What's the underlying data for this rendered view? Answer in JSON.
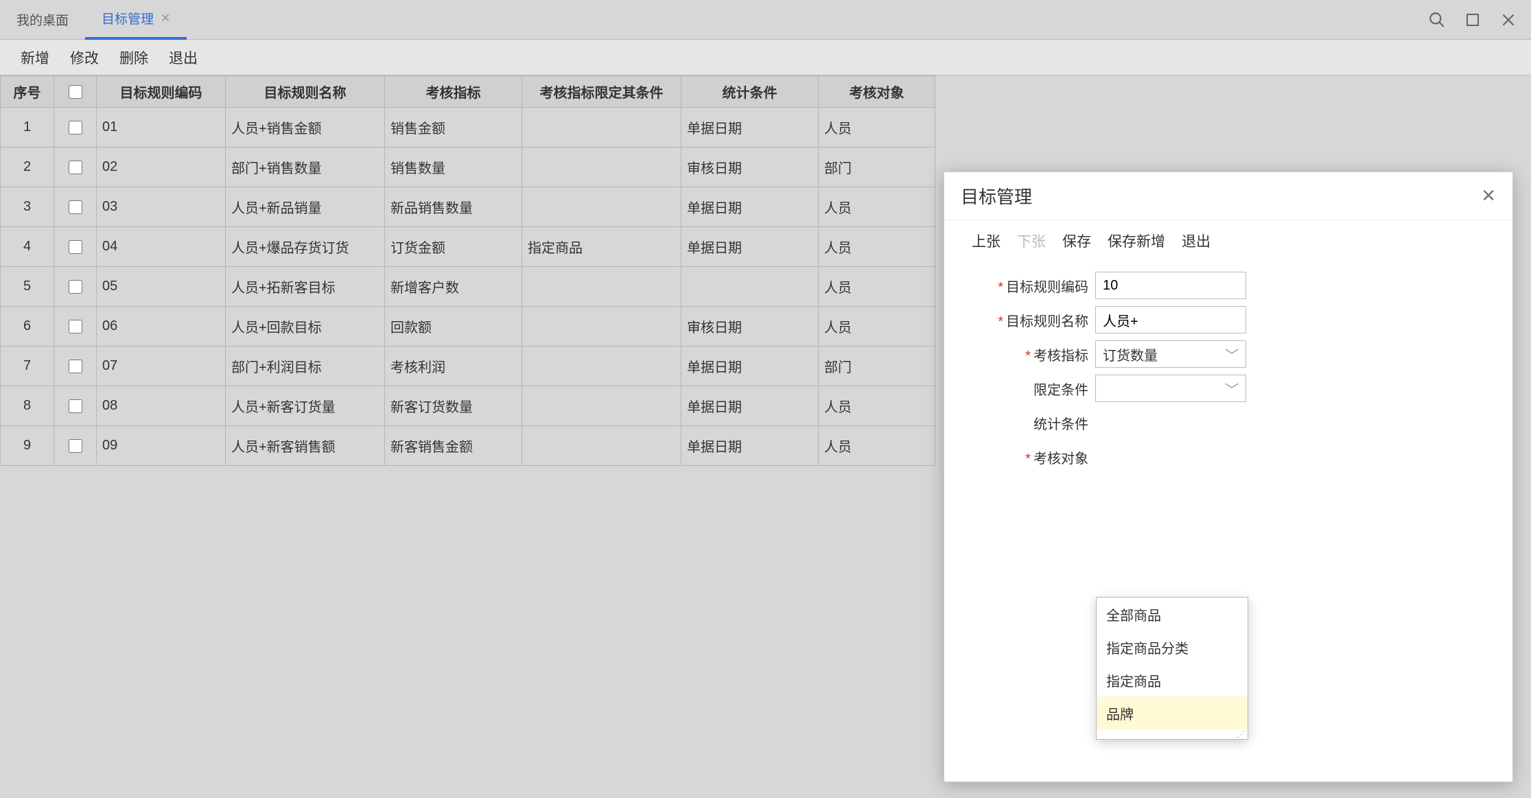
{
  "tabs": {
    "desktop": "我的桌面",
    "active": "目标管理"
  },
  "toolbar": {
    "add": "新增",
    "edit": "修改",
    "delete": "删除",
    "exit": "退出"
  },
  "columns": {
    "seq": "序号",
    "code": "目标规则编码",
    "name": "目标规则名称",
    "metric": "考核指标",
    "cond": "考核指标限定其条件",
    "stat": "统计条件",
    "target": "考核对象"
  },
  "rows": [
    {
      "seq": "1",
      "code": "01",
      "name": "人员+销售金额",
      "metric": "销售金额",
      "cond": "",
      "stat": "单据日期",
      "target": "人员"
    },
    {
      "seq": "2",
      "code": "02",
      "name": "部门+销售数量",
      "metric": "销售数量",
      "cond": "",
      "stat": "审核日期",
      "target": "部门"
    },
    {
      "seq": "3",
      "code": "03",
      "name": "人员+新品销量",
      "metric": "新品销售数量",
      "cond": "",
      "stat": "单据日期",
      "target": "人员"
    },
    {
      "seq": "4",
      "code": "04",
      "name": "人员+爆品存货订货",
      "metric": "订货金额",
      "cond": "指定商品",
      "stat": "单据日期",
      "target": "人员"
    },
    {
      "seq": "5",
      "code": "05",
      "name": "人员+拓新客目标",
      "metric": "新增客户数",
      "cond": "",
      "stat": "",
      "target": "人员"
    },
    {
      "seq": "6",
      "code": "06",
      "name": "人员+回款目标",
      "metric": "回款额",
      "cond": "",
      "stat": "审核日期",
      "target": "人员"
    },
    {
      "seq": "7",
      "code": "07",
      "name": "部门+利润目标",
      "metric": "考核利润",
      "cond": "",
      "stat": "单据日期",
      "target": "部门"
    },
    {
      "seq": "8",
      "code": "08",
      "name": "人员+新客订货量",
      "metric": "新客订货数量",
      "cond": "",
      "stat": "单据日期",
      "target": "人员"
    },
    {
      "seq": "9",
      "code": "09",
      "name": "人员+新客销售额",
      "metric": "新客销售金额",
      "cond": "",
      "stat": "单据日期",
      "target": "人员"
    }
  ],
  "dialog": {
    "title": "目标管理",
    "tb": {
      "prev": "上张",
      "next": "下张",
      "save": "保存",
      "saveadd": "保存新增",
      "exit": "退出"
    },
    "form": {
      "code_label": "目标规则编码",
      "code_value": "10",
      "name_label": "目标规则名称",
      "name_value": "人员+",
      "metric_label": "考核指标",
      "metric_value": "订货数量",
      "cond_label": "限定条件",
      "cond_value": "",
      "stat_label": "统计条件",
      "target_label": "考核对象"
    }
  },
  "dropdown": {
    "items": [
      "全部商品",
      "指定商品分类",
      "指定商品",
      "品牌"
    ],
    "hoverIndex": 3
  }
}
